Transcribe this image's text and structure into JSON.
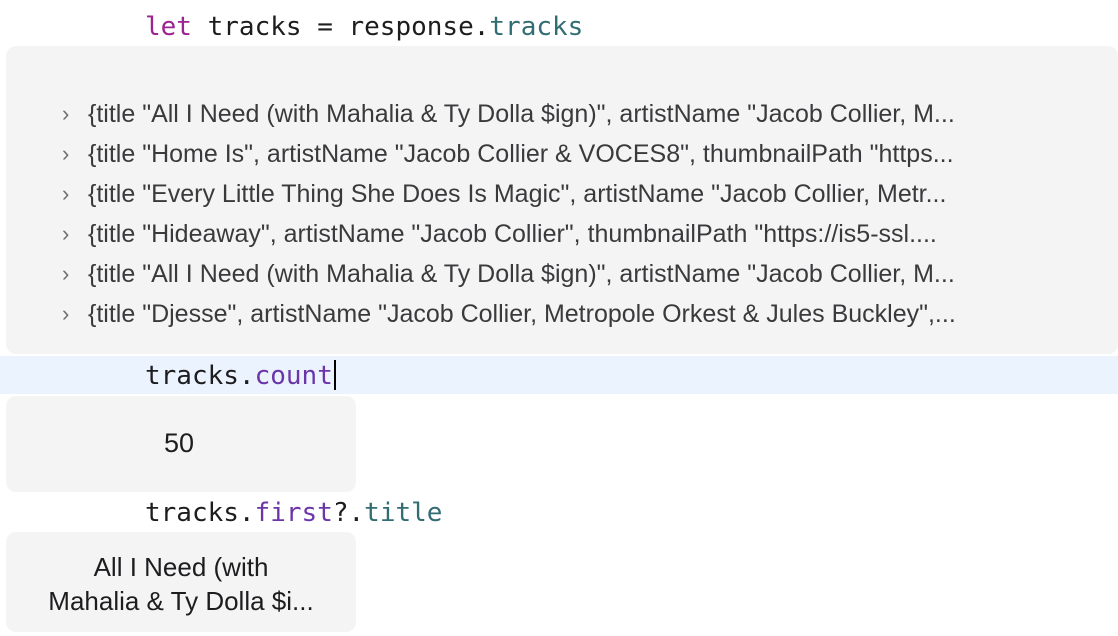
{
  "code": {
    "line1": {
      "kw": "let",
      "rest": " tracks = response.",
      "prop": "tracks"
    },
    "line2": {
      "obj": "tracks.",
      "member": "count"
    },
    "line3": {
      "obj": "tracks.",
      "member": "first",
      "opt": "?.",
      "prop": "title"
    }
  },
  "results": {
    "tracks_rows": [
      "{title \"All I Need (with Mahalia & Ty Dolla $ign)\", artistName \"Jacob Collier, M...",
      "{title \"Home Is\", artistName \"Jacob Collier & VOCES8\", thumbnailPath \"https...",
      "{title \"Every Little Thing She Does Is Magic\", artistName \"Jacob Collier, Metr...",
      "{title \"Hideaway\", artistName \"Jacob Collier\", thumbnailPath \"https://is5-ssl....",
      "{title \"All I Need (with Mahalia & Ty Dolla $ign)\", artistName \"Jacob Collier, M...",
      "{title \"Djesse\", artistName \"Jacob Collier, Metropole Orkest & Jules Buckley\",..."
    ],
    "count": "50",
    "first_title_line1": "All I Need (with",
    "first_title_line2": "Mahalia & Ty Dolla $i..."
  },
  "icons": {
    "row_chevron": "chevron-right-icon"
  }
}
